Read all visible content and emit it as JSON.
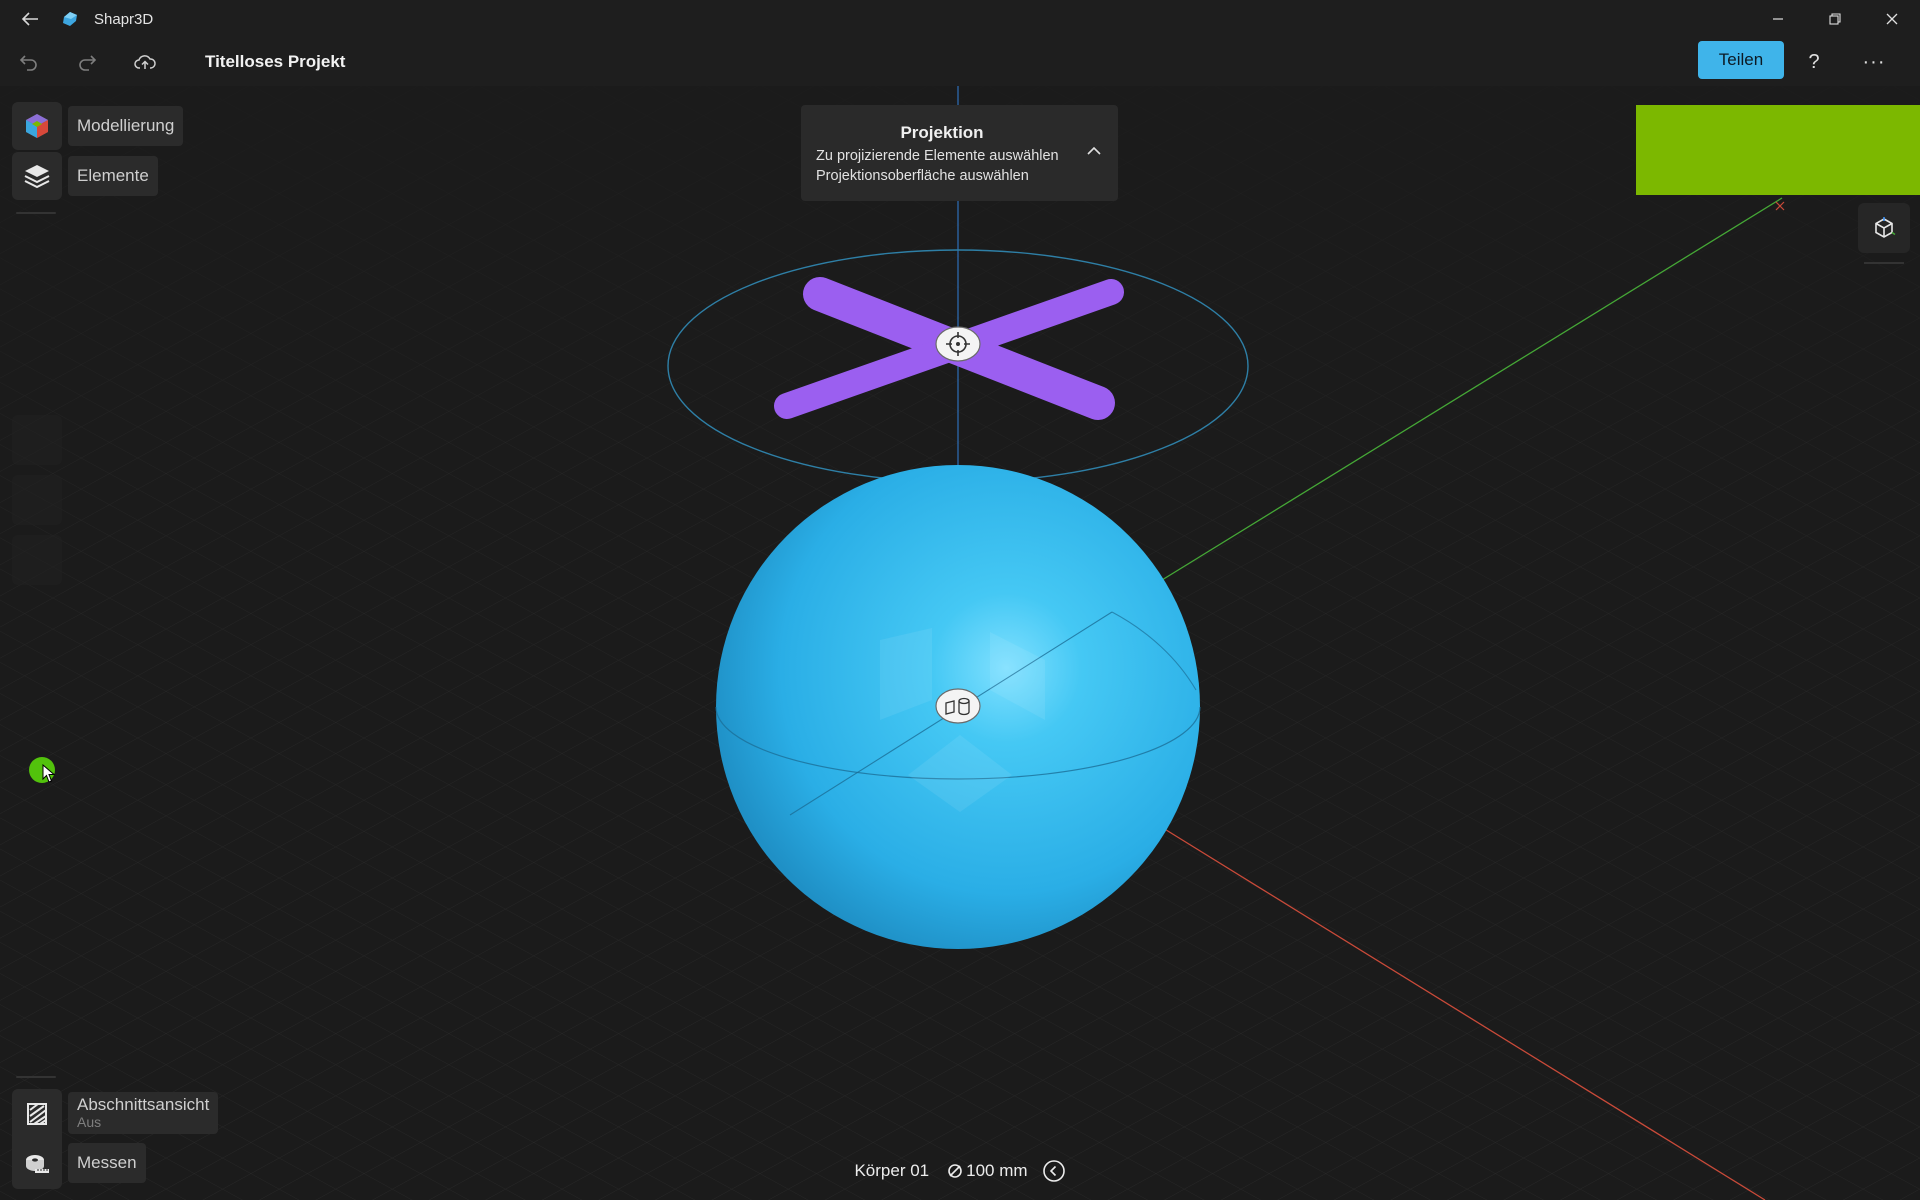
{
  "titlebar": {
    "app_name": "Shapr3D",
    "back_icon": "arrow-left-icon"
  },
  "window_controls": {
    "minimize": "minimize-icon",
    "restore": "restore-icon",
    "close": "close-icon"
  },
  "toolbar": {
    "undo_icon": "undo-icon",
    "redo_icon": "redo-icon",
    "upload_icon": "cloud-upload-icon",
    "project_title": "Titelloses Projekt",
    "share_label": "Teilen",
    "help_label": "?",
    "more_label": "···"
  },
  "sidebar_top": {
    "modeling": {
      "label": "Modellierung",
      "icon": "modeling-cube-icon"
    },
    "elements": {
      "label": "Elemente",
      "icon": "layers-icon"
    }
  },
  "sidebar_bottom": {
    "section_view": {
      "label": "Abschnittsansicht",
      "sublabel": "Aus",
      "icon": "section-view-icon"
    },
    "measure": {
      "label": "Messen",
      "icon": "measure-tape-icon"
    }
  },
  "projection_panel": {
    "title": "Projektion",
    "line1": "Zu projizierende Elemente auswählen",
    "line2": "Projektionsoberfläche auswählen",
    "collapse_icon": "chevron-up-icon"
  },
  "right_panel": {
    "viewcube_icon": "view-cube-icon",
    "overlay_color": "#7cb800"
  },
  "status": {
    "body_name": "Körper 01",
    "diameter_value": "100 mm",
    "diameter_icon": "diameter-icon",
    "back_icon": "back-circle-icon"
  },
  "colors": {
    "accent": "#3fb4ea",
    "sphere": "#35b9ec",
    "sketch": "#9b5ff0",
    "axis_x": "#d24a3a",
    "axis_y": "#49b53a",
    "axis_z": "#2f7fd4"
  }
}
